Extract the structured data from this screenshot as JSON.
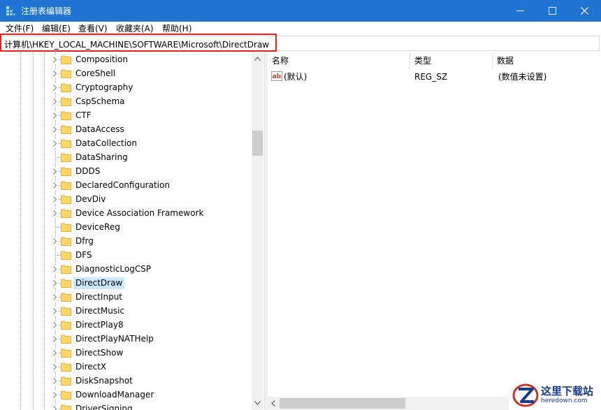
{
  "window": {
    "title": "注册表编辑器",
    "minimize_icon": "minimize-icon",
    "maximize_icon": "maximize-icon",
    "close_icon": "close-icon",
    "title_bar_color": "#1e74d0"
  },
  "menu": [
    {
      "label": "文件(F)"
    },
    {
      "label": "编辑(E)"
    },
    {
      "label": "查看(V)"
    },
    {
      "label": "收藏夹(A)"
    },
    {
      "label": "帮助(H)"
    }
  ],
  "address": {
    "path": "计算机\\HKEY_LOCAL_MACHINE\\SOFTWARE\\Microsoft\\DirectDraw",
    "highlight_color": "#e0231e"
  },
  "tree": {
    "items": [
      {
        "label": "Composition",
        "expandable": true,
        "selected": false
      },
      {
        "label": "CoreShell",
        "expandable": true,
        "selected": false
      },
      {
        "label": "Cryptography",
        "expandable": true,
        "selected": false
      },
      {
        "label": "CspSchema",
        "expandable": true,
        "selected": false
      },
      {
        "label": "CTF",
        "expandable": true,
        "selected": false
      },
      {
        "label": "DataAccess",
        "expandable": true,
        "selected": false
      },
      {
        "label": "DataCollection",
        "expandable": true,
        "selected": false
      },
      {
        "label": "DataSharing",
        "expandable": false,
        "selected": false
      },
      {
        "label": "DDDS",
        "expandable": true,
        "selected": false
      },
      {
        "label": "DeclaredConfiguration",
        "expandable": true,
        "selected": false
      },
      {
        "label": "DevDiv",
        "expandable": true,
        "selected": false
      },
      {
        "label": "Device Association Framework",
        "expandable": true,
        "selected": false
      },
      {
        "label": "DeviceReg",
        "expandable": false,
        "selected": false
      },
      {
        "label": "Dfrg",
        "expandable": true,
        "selected": false
      },
      {
        "label": "DFS",
        "expandable": false,
        "selected": false
      },
      {
        "label": "DiagnosticLogCSP",
        "expandable": true,
        "selected": false
      },
      {
        "label": "DirectDraw",
        "expandable": true,
        "selected": true
      },
      {
        "label": "DirectInput",
        "expandable": true,
        "selected": false
      },
      {
        "label": "DirectMusic",
        "expandable": true,
        "selected": false
      },
      {
        "label": "DirectPlay8",
        "expandable": true,
        "selected": false
      },
      {
        "label": "DirectPlayNATHelp",
        "expandable": true,
        "selected": false
      },
      {
        "label": "DirectShow",
        "expandable": true,
        "selected": false
      },
      {
        "label": "DirectX",
        "expandable": true,
        "selected": false
      },
      {
        "label": "DiskSnapshot",
        "expandable": true,
        "selected": false
      },
      {
        "label": "DownloadManager",
        "expandable": true,
        "selected": false
      },
      {
        "label": "DriverSigning",
        "expandable": true,
        "selected": false
      }
    ],
    "scroll_position": 0.25,
    "folder_color": "#ffd865",
    "selection_color": "#cce8ff"
  },
  "list": {
    "columns": [
      {
        "label": "名称"
      },
      {
        "label": "类型"
      },
      {
        "label": "数据"
      }
    ],
    "rows": [
      {
        "icon": "string-value-icon",
        "name": "(默认)",
        "type": "REG_SZ",
        "data": "(数值未设置)"
      }
    ]
  },
  "watermark": {
    "text": "这里下载站",
    "sub": "heredown.com"
  }
}
